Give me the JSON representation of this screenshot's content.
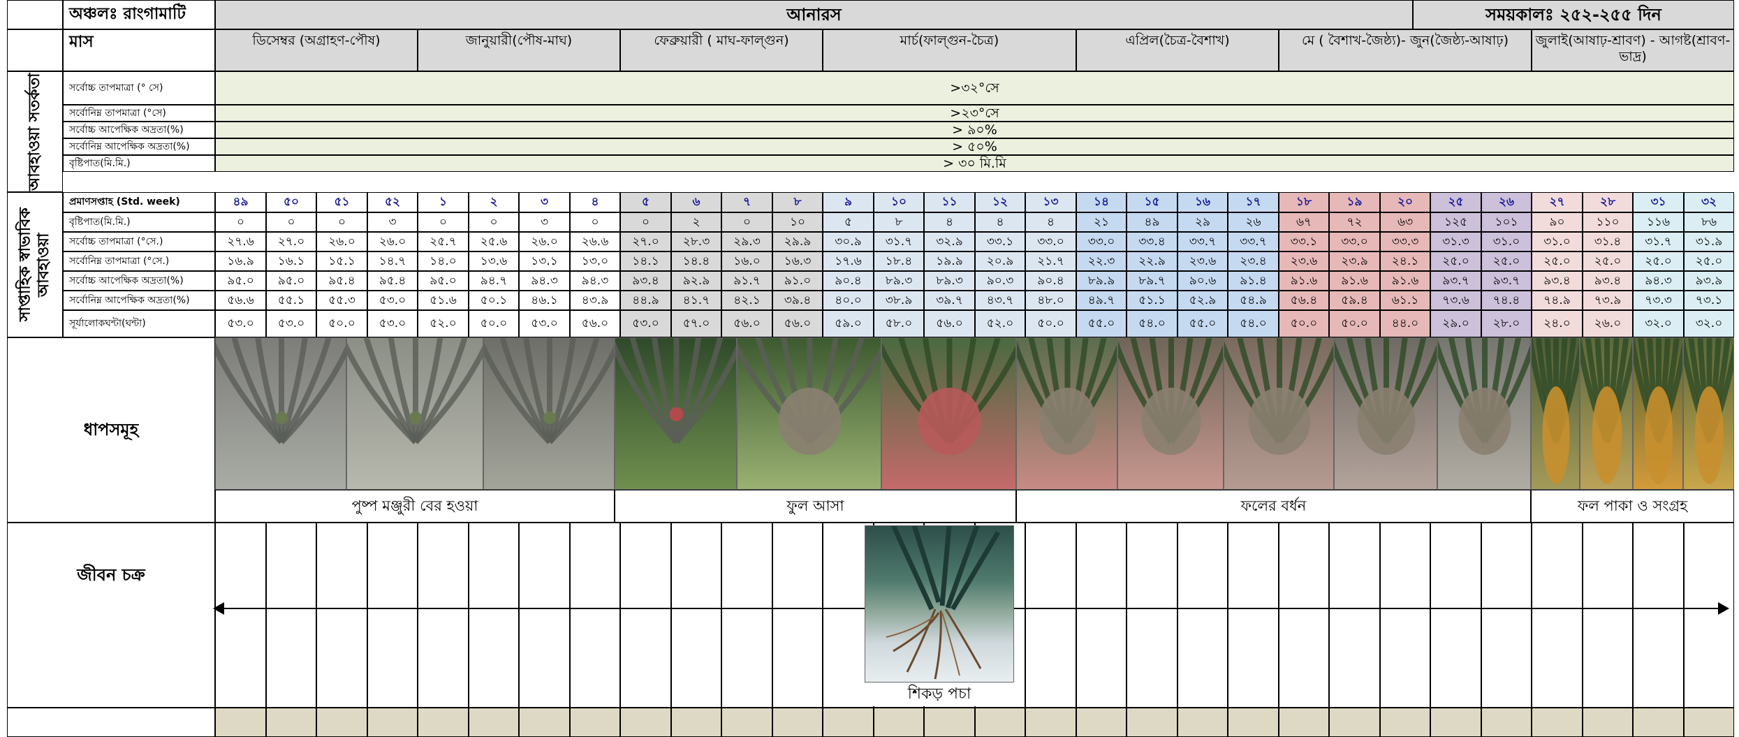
{
  "header": {
    "region": "অঞ্চলঃ রাংগামাটি",
    "crop": "আনারস",
    "duration": "সময়কালঃ ২৫২-২৫৫ দিন"
  },
  "row_labels": {
    "month": "মাস",
    "weather_warning": "আবহাওয়া সতর্কতা",
    "weekly_weather": "সাপ্তাহিক স্বাভাবিক আবহাওয়া",
    "stages": "ধাপসমূহ",
    "life_cycle": "জীবন চক্র"
  },
  "months": [
    "ডিসেম্বর (অগ্রাহণ-পৌষ)",
    "জানুয়ারী(পৌষ-মাঘ)",
    "ফেব্রুয়ারী ( মাঘ-ফাল্গুন)",
    "মার্চ(ফাল্গুন-চৈত্র)",
    "এপ্রিল(চৈত্র-বৈশাখ)",
    "মে ( বৈশাখ-জৈষ্ঠ্য)- জুন(জৈষ্ঠ্য-আষাঢ়)",
    "জুলাই(আষাঢ়-শ্রাবণ) - আগষ্ট(শ্রাবণ-ভাদ্র)"
  ],
  "warnings": [
    {
      "label": "সর্বোচ্চ তাপমাত্রা (° সে)",
      "value": ">৩২°সে"
    },
    {
      "label": "সর্বোনিম্ন তাপমাত্রা (°সে)",
      "value": ">২৩°সে"
    },
    {
      "label": "সর্বোচ্চ আপেক্ষিক অদ্রতা(%)",
      "value": "> ৯০%"
    },
    {
      "label": "সর্বোনিম্ন আপেক্ষিক অদ্রতা(%)",
      "value": "> ৫০%"
    },
    {
      "label": "বৃষ্টিপাত(মি.মি.)",
      "value": "> ৩০ মি.মি"
    }
  ],
  "std_week_label": "প্রমাণসপ্তাহ (Std. week)",
  "std_weeks": [
    "৪৯",
    "৫০",
    "৫১",
    "৫২",
    "১",
    "২",
    "৩",
    "৪",
    "৫",
    "৬",
    "৭",
    "৮",
    "৯",
    "১০",
    "১১",
    "১২",
    "১৩",
    "১৪",
    "১৫",
    "১৬",
    "১৭",
    "১৮",
    "১৯",
    "২০",
    "২৫",
    "২৬",
    "২৭",
    "২৮",
    "৩১",
    "৩২"
  ],
  "weather_rows": [
    {
      "label": "বৃষ্টিপাত(মি.মি.)",
      "values": [
        "০",
        "০",
        "০",
        "৩",
        "০",
        "০",
        "৩",
        "০",
        "০",
        "২",
        "০",
        "১০",
        "৫",
        "৮",
        "৪",
        "৪",
        "৪",
        "২১",
        "৪৯",
        "২৯",
        "২৬",
        "৬৭",
        "৭২",
        "৬৩",
        "১২৫",
        "১০১",
        "৯০",
        "১১০",
        "১১৬",
        "৮৬"
      ]
    },
    {
      "label": "সর্বোচ্চ তাপমাত্রা (°সে.)",
      "values": [
        "২৭.৬",
        "২৭.০",
        "২৬.০",
        "২৬.০",
        "২৫.৭",
        "২৫.৬",
        "২৬.০",
        "২৬.৬",
        "২৭.০",
        "২৮.৩",
        "২৯.৩",
        "২৯.৯",
        "৩০.৯",
        "৩১.৭",
        "৩২.৯",
        "৩৩.১",
        "৩৩.০",
        "৩৩.০",
        "৩৩.৪",
        "৩৩.৭",
        "৩৩.৭",
        "৩৩.১",
        "৩৩.০",
        "৩৩.৩",
        "৩১.৩",
        "৩১.০",
        "৩১.০",
        "৩১.৪",
        "৩১.৭",
        "৩১.৯"
      ]
    },
    {
      "label": "সর্বোনিম্ন তাপমাত্রা (°সে.)",
      "values": [
        "১৬.৯",
        "১৬.১",
        "১৫.১",
        "১৪.৭",
        "১৪.০",
        "১৩.৬",
        "১৩.১",
        "১৩.০",
        "১৪.১",
        "১৪.৪",
        "১৬.০",
        "১৬.৩",
        "১৭.৬",
        "১৮.৪",
        "১৯.৯",
        "২০.৯",
        "২১.৭",
        "২২.৩",
        "২২.৯",
        "২৩.৬",
        "২৩.৪",
        "২৩.৬",
        "২৩.৯",
        "২৪.১",
        "২৫.০",
        "২৫.০",
        "২৫.০",
        "২৫.০",
        "২৫.০",
        "২৫.০"
      ]
    },
    {
      "label": "সর্বোচ্চ আপেক্ষিক অদ্রতা(%)",
      "values": [
        "৯৫.০",
        "৯৫.০",
        "৯৫.৪",
        "৯৫.৪",
        "৯৫.০",
        "৯৪.৭",
        "৯৪.৩",
        "৯৪.৩",
        "৯৩.৪",
        "৯২.৯",
        "৯১.৭",
        "৯১.০",
        "৯০.৪",
        "৮৯.৩",
        "৮৯.৩",
        "৯০.৩",
        "৯০.৪",
        "৮৯.৯",
        "৮৯.৭",
        "৯০.৬",
        "৯১.৪",
        "৯১.৬",
        "৯১.৬",
        "৯১.৬",
        "৯৩.৭",
        "৯৩.৭",
        "৯৩.৪",
        "৯৩.৪",
        "৯৪.৩",
        "৯৩.৯"
      ]
    },
    {
      "label": "সর্বোনিম্ন আপেক্ষিক অদ্রতা(%)",
      "values": [
        "৫৬.৬",
        "৫৫.১",
        "৫৫.৩",
        "৫৩.০",
        "৫১.৬",
        "৫০.১",
        "৪৬.১",
        "৪৩.৯",
        "৪৪.৯",
        "৪১.৭",
        "৪২.১",
        "৩৯.৪",
        "৪০.০",
        "৩৮.৯",
        "৩৯.৭",
        "৪৩.৭",
        "৪৮.০",
        "৪৯.৭",
        "৫১.১",
        "৫২.৯",
        "৫৪.৯",
        "৫৬.৪",
        "৫৯.৪",
        "৬১.১",
        "৭৩.৬",
        "৭৪.৪",
        "৭৪.৯",
        "৭৩.৯",
        "৭৩.৩",
        "৭৩.১"
      ]
    },
    {
      "label": "সূর্যালোকঘন্টা(ঘন্টা)",
      "values": [
        "৫৩.০",
        "৫৩.০",
        "৫০.০",
        "৫৩.০",
        "৫২.০",
        "৫০.০",
        "৫৩.০",
        "৫৬.০",
        "৫৩.০",
        "৫৭.০",
        "৫৬.০",
        "৫৬.০",
        "৫৯.০",
        "৫৮.০",
        "৫৬.০",
        "৫২.০",
        "৫০.০",
        "৫৫.০",
        "৫৪.০",
        "৫৫.০",
        "৫৪.০",
        "৫০.০",
        "৫০.০",
        "৪৪.০",
        "২৯.০",
        "২৮.০",
        "২৪.০",
        "২৬.০",
        "৩২.০",
        "৩২.০"
      ]
    }
  ],
  "stages": [
    "পুষ্প মঞ্জুরী বের হওয়া",
    "ফুল আসা",
    "ফলের বর্ধন",
    "ফল পাকা ও সংগ্রহ"
  ],
  "pest": "শিকড় পচা"
}
